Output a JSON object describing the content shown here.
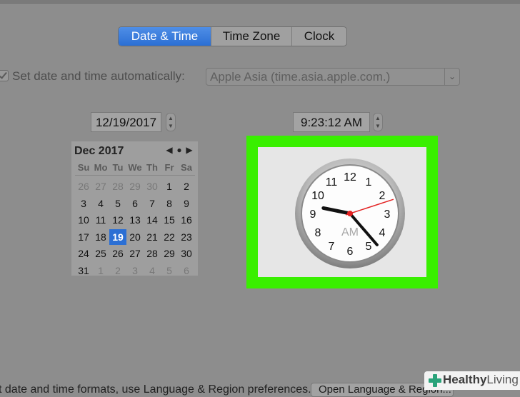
{
  "tabs": [
    {
      "label": "Date & Time",
      "active": true
    },
    {
      "label": "Time Zone",
      "active": false
    },
    {
      "label": "Clock",
      "active": false
    }
  ],
  "auto": {
    "checked": true,
    "label": "Set date and time automatically:",
    "server": "Apple Asia (time.asia.apple.com.)"
  },
  "date_field": "12/19/2017",
  "time_field": "9:23:12 AM",
  "calendar": {
    "month_label": "Dec 2017",
    "weekdays": [
      "Su",
      "Mo",
      "Tu",
      "We",
      "Th",
      "Fr",
      "Sa"
    ],
    "days": [
      {
        "d": "26",
        "m": true
      },
      {
        "d": "27",
        "m": true
      },
      {
        "d": "28",
        "m": true
      },
      {
        "d": "29",
        "m": true
      },
      {
        "d": "30",
        "m": true
      },
      {
        "d": "1"
      },
      {
        "d": "2"
      },
      {
        "d": "3"
      },
      {
        "d": "4"
      },
      {
        "d": "5"
      },
      {
        "d": "6"
      },
      {
        "d": "7"
      },
      {
        "d": "8"
      },
      {
        "d": "9"
      },
      {
        "d": "10"
      },
      {
        "d": "11"
      },
      {
        "d": "12"
      },
      {
        "d": "13"
      },
      {
        "d": "14"
      },
      {
        "d": "15"
      },
      {
        "d": "16"
      },
      {
        "d": "17"
      },
      {
        "d": "18"
      },
      {
        "d": "19",
        "sel": true
      },
      {
        "d": "20"
      },
      {
        "d": "21"
      },
      {
        "d": "22"
      },
      {
        "d": "23"
      },
      {
        "d": "24"
      },
      {
        "d": "25"
      },
      {
        "d": "26"
      },
      {
        "d": "27"
      },
      {
        "d": "28"
      },
      {
        "d": "29"
      },
      {
        "d": "30"
      },
      {
        "d": "31"
      },
      {
        "d": "1",
        "m": true
      },
      {
        "d": "2",
        "m": true
      },
      {
        "d": "3",
        "m": true
      },
      {
        "d": "4",
        "m": true
      },
      {
        "d": "5",
        "m": true
      },
      {
        "d": "6",
        "m": true
      }
    ]
  },
  "clock": {
    "numbers": [
      "12",
      "1",
      "2",
      "3",
      "4",
      "5",
      "6",
      "7",
      "8",
      "9",
      "10",
      "11"
    ],
    "period": "AM",
    "hours": 9,
    "minutes": 23,
    "seconds": 12,
    "highlight_color": "#39ef00",
    "second_hand_color": "#e32222"
  },
  "bottom": {
    "text": "t date and time formats, use Language & Region preferences.",
    "button": "Open Language & Region..."
  },
  "watermark": {
    "brand_bold": "Healthy",
    "brand_light": "Living"
  }
}
